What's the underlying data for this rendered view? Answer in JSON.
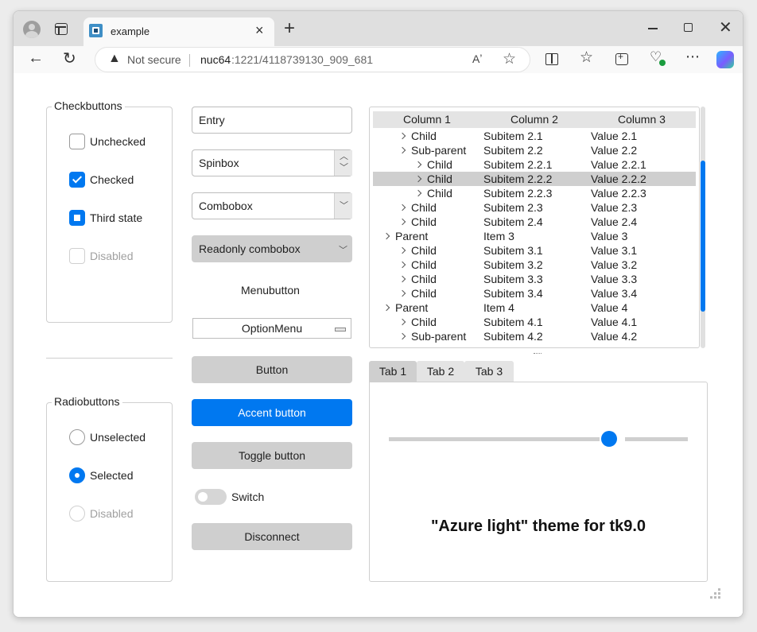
{
  "browser": {
    "tab_title": "example",
    "new_tab_glyph": "+",
    "security_label": "Not secure",
    "url_host": "nuc64",
    "url_rest": ":1221/4118739130_909_681",
    "window_controls": [
      "minimize",
      "maximize",
      "close"
    ],
    "icons": [
      "profile-icon",
      "tab-actions-icon",
      "app-favicon",
      "tab-close-icon",
      "back-icon",
      "refresh-icon",
      "warning-icon",
      "read-aloud-icon",
      "favorite-star-icon",
      "split-screen-icon",
      "favorites-icon",
      "collections-icon",
      "browser-essentials-icon",
      "more-icon",
      "copilot-icon"
    ]
  },
  "checkbuttons": {
    "title": "Checkbuttons",
    "items": [
      {
        "label": "Unchecked",
        "state": "unchecked"
      },
      {
        "label": "Checked",
        "state": "checked"
      },
      {
        "label": "Third state",
        "state": "tristate"
      },
      {
        "label": "Disabled",
        "state": "disabled"
      }
    ]
  },
  "radiobuttons": {
    "title": "Radiobuttons",
    "items": [
      {
        "label": "Unselected",
        "state": "unselected"
      },
      {
        "label": "Selected",
        "state": "selected"
      },
      {
        "label": "Disabled",
        "state": "disabled"
      }
    ]
  },
  "widgets": {
    "entry_value": "Entry",
    "spinbox_value": "Spinbox",
    "combobox_value": "Combobox",
    "readonly_combobox_value": "Readonly combobox",
    "menubutton_label": "Menubutton",
    "optionmenu_label": "OptionMenu",
    "button_label": "Button",
    "accent_button_label": "Accent button",
    "toggle_button_label": "Toggle button",
    "switch_label": "Switch",
    "switch_on": false,
    "disconnect_label": "Disconnect"
  },
  "treeview": {
    "columns": [
      "Column 1",
      "Column 2",
      "Column 3"
    ],
    "rows": [
      {
        "c1": "Child",
        "c2": "Subitem 2.1",
        "c3": "Value 2.1",
        "level": 1
      },
      {
        "c1": "Sub-parent",
        "c2": "Subitem 2.2",
        "c3": "Value 2.2",
        "level": 1
      },
      {
        "c1": "Child",
        "c2": "Subitem 2.2.1",
        "c3": "Value 2.2.1",
        "level": 2
      },
      {
        "c1": "Child",
        "c2": "Subitem 2.2.2",
        "c3": "Value 2.2.2",
        "level": 2,
        "selected": true
      },
      {
        "c1": "Child",
        "c2": "Subitem 2.2.3",
        "c3": "Value 2.2.3",
        "level": 2
      },
      {
        "c1": "Child",
        "c2": "Subitem 2.3",
        "c3": "Value 2.3",
        "level": 1
      },
      {
        "c1": "Child",
        "c2": "Subitem 2.4",
        "c3": "Value 2.4",
        "level": 1
      },
      {
        "c1": "Parent",
        "c2": "Item 3",
        "c3": "Value 3",
        "level": 0
      },
      {
        "c1": "Child",
        "c2": "Subitem 3.1",
        "c3": "Value 3.1",
        "level": 1
      },
      {
        "c1": "Child",
        "c2": "Subitem 3.2",
        "c3": "Value 3.2",
        "level": 1
      },
      {
        "c1": "Child",
        "c2": "Subitem 3.3",
        "c3": "Value 3.3",
        "level": 1
      },
      {
        "c1": "Child",
        "c2": "Subitem 3.4",
        "c3": "Value 3.4",
        "level": 1
      },
      {
        "c1": "Parent",
        "c2": "Item 4",
        "c3": "Value 4",
        "level": 0
      },
      {
        "c1": "Child",
        "c2": "Subitem 4.1",
        "c3": "Value 4.1",
        "level": 1
      },
      {
        "c1": "Sub-parent",
        "c2": "Subitem 4.2",
        "c3": "Value 4.2",
        "level": 1
      }
    ]
  },
  "notebook": {
    "tabs": [
      "Tab 1",
      "Tab 2",
      "Tab 3"
    ],
    "active_tab": 0,
    "slider_value": 0.75,
    "theme_label": "\"Azure light\" theme for tk9.0"
  },
  "colors": {
    "accent": "#0078f0",
    "button": "#cfcfcf"
  }
}
